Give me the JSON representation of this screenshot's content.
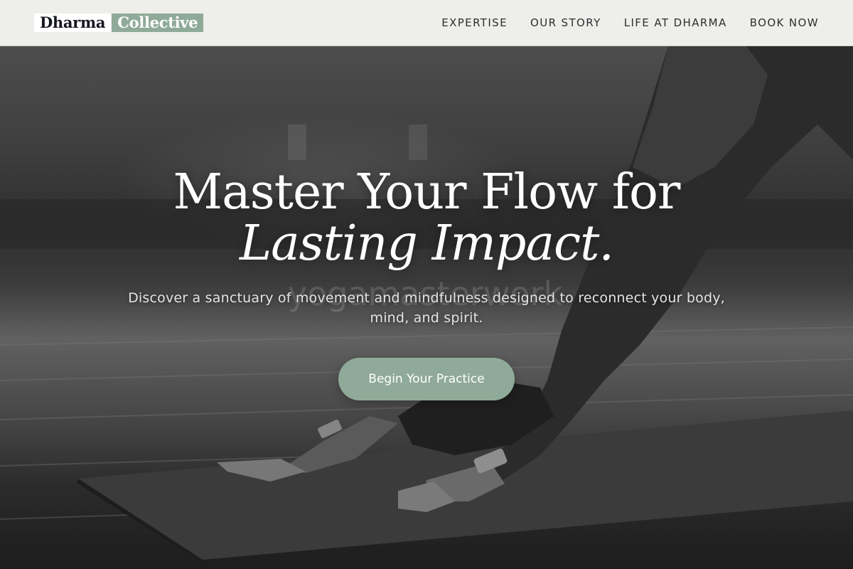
{
  "brand": {
    "part1": "Dharma",
    "part2": "Collective",
    "accent_color": "#8faa98"
  },
  "nav": {
    "items": [
      {
        "label": "EXPERTISE"
      },
      {
        "label": "OUR STORY"
      },
      {
        "label": "LIFE AT DHARMA"
      },
      {
        "label": "BOOK NOW"
      }
    ]
  },
  "hero": {
    "title_line1": "Master Your Flow for",
    "title_line2": "Lasting Impact.",
    "watermark": "yogamasterwork",
    "subtitle": "Discover a sanctuary of movement and mindfulness designed to reconnect your body, mind, and spirit.",
    "cta_label": "Begin Your Practice",
    "image_subject": "black-and-white photo of a person in downward-facing dog on a yoga mat"
  }
}
